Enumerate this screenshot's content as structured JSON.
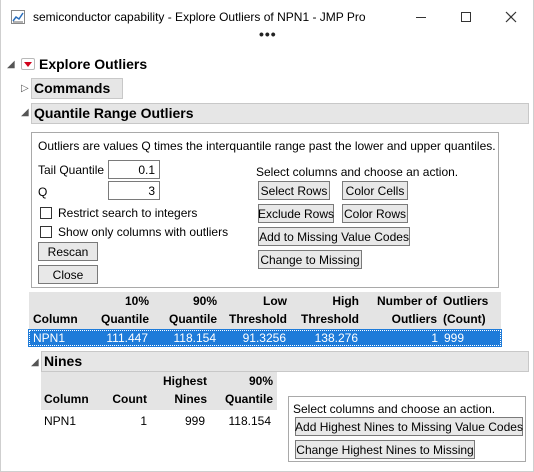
{
  "window": {
    "title": "semiconductor capability - Explore Outliers of NPN1 - JMP Pro",
    "overflow_dots": "•••"
  },
  "outline": {
    "explore_outliers": "Explore Outliers",
    "commands": "Commands",
    "quantile_range_outliers": "Quantile Range Outliers",
    "nines": "Nines"
  },
  "quantile_panel": {
    "description": "Outliers are values Q times the interquantile range past the lower and upper quantiles.",
    "tail_quantile_label": "Tail Quantile",
    "tail_quantile_value": "0.1",
    "q_label": "Q",
    "q_value": "3",
    "restrict_integers_label": "Restrict search to integers",
    "restrict_integers_checked": false,
    "show_only_outliers_label": "Show only columns with outliers",
    "show_only_outliers_checked": false,
    "rescan_label": "Rescan",
    "close_label": "Close",
    "action_prompt": "Select columns and choose an action.",
    "select_rows_label": "Select Rows",
    "color_cells_label": "Color Cells",
    "exclude_rows_label": "Exclude Rows",
    "color_rows_label": "Color Rows",
    "add_missing_codes_label": "Add to Missing Value Codes",
    "change_to_missing_label": "Change to Missing"
  },
  "outlier_table": {
    "headers": [
      [
        "",
        "Column"
      ],
      [
        "10%",
        "Quantile"
      ],
      [
        "90%",
        "Quantile"
      ],
      [
        "Low",
        "Threshold"
      ],
      [
        "High",
        "Threshold"
      ],
      [
        "Number of",
        "Outliers"
      ],
      [
        "Outliers",
        "(Count)"
      ]
    ],
    "rows": [
      [
        "NPN1",
        "111.447",
        "118.154",
        "91.3256",
        "138.276",
        "1",
        "999"
      ]
    ],
    "selected_color": "#1e7bd9"
  },
  "nines_table": {
    "headers": [
      [
        "",
        "Column"
      ],
      [
        "",
        "Count"
      ],
      [
        "Highest",
        "Nines"
      ],
      [
        "90%",
        "Quantile"
      ]
    ],
    "rows": [
      [
        "NPN1",
        "1",
        "999",
        "118.154"
      ]
    ],
    "action_prompt": "Select columns and choose an action.",
    "add_highest_nines_label": "Add Highest Nines to Missing Value Codes",
    "change_highest_nines_label": "Change Highest Nines to Missing"
  },
  "colors": {
    "header_bar": "#e6e6e6",
    "red_triangle": "#d0021b"
  }
}
